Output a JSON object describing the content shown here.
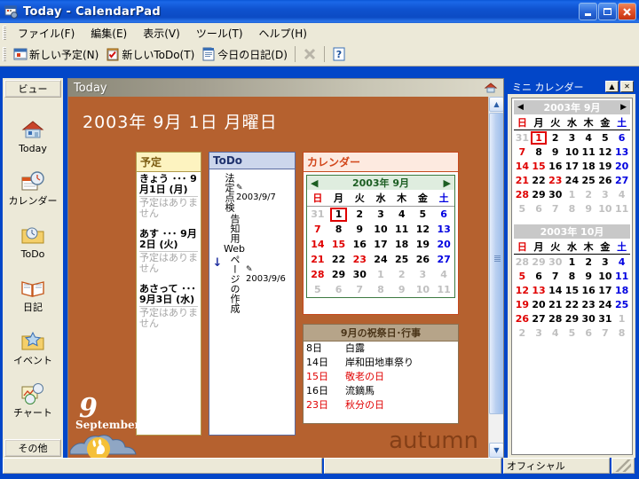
{
  "window": {
    "title": "Today - CalendarPad",
    "icon": "calendar-app-icon",
    "minimize": "_",
    "maximize": "□",
    "close": "✕"
  },
  "menubar": {
    "items": [
      {
        "label": "ファイル(F)",
        "name": "menu-file"
      },
      {
        "label": "編集(E)",
        "name": "menu-edit"
      },
      {
        "label": "表示(V)",
        "name": "menu-view"
      },
      {
        "label": "ツール(T)",
        "name": "menu-tools"
      },
      {
        "label": "ヘルプ(H)",
        "name": "menu-help"
      }
    ]
  },
  "toolbar": {
    "new_schedule": "新しい予定(N)",
    "new_todo": "新しいToDo(T)",
    "today_diary": "今日の日記(D)",
    "delete_label": "✕",
    "help_label": "?"
  },
  "sidebar": {
    "header": "ビュー",
    "footer": "その他",
    "items": [
      {
        "label": "Today",
        "icon": "house-icon"
      },
      {
        "label": "カレンダー",
        "icon": "calendar-clock-icon"
      },
      {
        "label": "ToDo",
        "icon": "folder-check-icon"
      },
      {
        "label": "日記",
        "icon": "open-book-icon"
      },
      {
        "label": "イベント",
        "icon": "folder-star-icon"
      },
      {
        "label": "チャート",
        "icon": "chart-clock-icon"
      }
    ]
  },
  "main": {
    "header_title": "Today",
    "header_icon": "house-icon",
    "big_date": "2003年 9月 1日 月曜日",
    "month_number": "9",
    "month_name": "September",
    "season_word": "autumn",
    "schedule_panel": {
      "title": "予定",
      "entries": [
        {
          "date": "きょう ･･･ 9月1日 (月)",
          "note": "予定はありません"
        },
        {
          "date": "あす ･･･ 9月2日 (火)",
          "note": "予定はありません"
        },
        {
          "date": "あさって ･･･ 9月3日 (水)",
          "note": "予定はありません"
        }
      ]
    },
    "todo_panel": {
      "title": "ToDo",
      "items": [
        {
          "marker": "",
          "text": "法定点検",
          "due": "2003/9/7",
          "due_icon": "pencil-icon"
        },
        {
          "marker": "↓",
          "text_pre": "告知用",
          "text_latin": "Web",
          "text_post": "ページの作成",
          "due": "2003/9/6",
          "due_icon": "pencil-icon"
        }
      ]
    },
    "calendar_panel": {
      "title": "カレンダー",
      "nav_prev": "◀",
      "nav_next": "▶",
      "month_title": "2003年 9月",
      "weekdays": [
        "日",
        "月",
        "火",
        "水",
        "木",
        "金",
        "土"
      ],
      "weeks": [
        [
          {
            "d": "31",
            "t": "out"
          },
          {
            "d": "1",
            "t": "today"
          },
          {
            "d": "2",
            "t": "wk"
          },
          {
            "d": "3",
            "t": "wk"
          },
          {
            "d": "4",
            "t": "wk"
          },
          {
            "d": "5",
            "t": "wk"
          },
          {
            "d": "6",
            "t": "sat"
          }
        ],
        [
          {
            "d": "7",
            "t": "sun"
          },
          {
            "d": "8",
            "t": "wk"
          },
          {
            "d": "9",
            "t": "wk"
          },
          {
            "d": "10",
            "t": "wk"
          },
          {
            "d": "11",
            "t": "wk"
          },
          {
            "d": "12",
            "t": "wk"
          },
          {
            "d": "13",
            "t": "sat"
          }
        ],
        [
          {
            "d": "14",
            "t": "sun"
          },
          {
            "d": "15",
            "t": "sun"
          },
          {
            "d": "16",
            "t": "wk"
          },
          {
            "d": "17",
            "t": "wk"
          },
          {
            "d": "18",
            "t": "wk"
          },
          {
            "d": "19",
            "t": "wk"
          },
          {
            "d": "20",
            "t": "sat"
          }
        ],
        [
          {
            "d": "21",
            "t": "sun"
          },
          {
            "d": "22",
            "t": "wk"
          },
          {
            "d": "23",
            "t": "sun"
          },
          {
            "d": "24",
            "t": "wk"
          },
          {
            "d": "25",
            "t": "wk"
          },
          {
            "d": "26",
            "t": "wk"
          },
          {
            "d": "27",
            "t": "sat"
          }
        ],
        [
          {
            "d": "28",
            "t": "sun"
          },
          {
            "d": "29",
            "t": "wk"
          },
          {
            "d": "30",
            "t": "wk"
          },
          {
            "d": "1",
            "t": "out"
          },
          {
            "d": "2",
            "t": "out"
          },
          {
            "d": "3",
            "t": "out"
          },
          {
            "d": "4",
            "t": "out"
          }
        ],
        [
          {
            "d": "5",
            "t": "out"
          },
          {
            "d": "6",
            "t": "out"
          },
          {
            "d": "7",
            "t": "out"
          },
          {
            "d": "8",
            "t": "out"
          },
          {
            "d": "9",
            "t": "out"
          },
          {
            "d": "10",
            "t": "out"
          },
          {
            "d": "11",
            "t": "out"
          }
        ]
      ]
    },
    "holiday_panel": {
      "title": "9月の祝祭日･行事",
      "rows": [
        {
          "day": "8日",
          "name": "白露",
          "red": false
        },
        {
          "day": "14日",
          "name": "岸和田地車祭り",
          "red": false
        },
        {
          "day": "15日",
          "name": "敬老の日",
          "red": true
        },
        {
          "day": "16日",
          "name": "流鏑馬",
          "red": false
        },
        {
          "day": "23日",
          "name": "秋分の日",
          "red": true
        }
      ]
    }
  },
  "dock": {
    "title": "ミニ カレンダー",
    "btn_roll": "▲",
    "btn_close": "✕",
    "months": [
      {
        "nav_prev": "◀",
        "nav_next": "▶",
        "title": "2003年 9月",
        "weekdays": [
          "日",
          "月",
          "火",
          "水",
          "木",
          "金",
          "土"
        ],
        "weeks": [
          [
            {
              "d": "31",
              "t": "out"
            },
            {
              "d": "1",
              "t": "today"
            },
            {
              "d": "2",
              "t": "wk"
            },
            {
              "d": "3",
              "t": "wk"
            },
            {
              "d": "4",
              "t": "wk"
            },
            {
              "d": "5",
              "t": "wk"
            },
            {
              "d": "6",
              "t": "sat"
            }
          ],
          [
            {
              "d": "7",
              "t": "sun"
            },
            {
              "d": "8",
              "t": "wk"
            },
            {
              "d": "9",
              "t": "wk"
            },
            {
              "d": "10",
              "t": "wk"
            },
            {
              "d": "11",
              "t": "wk"
            },
            {
              "d": "12",
              "t": "wk"
            },
            {
              "d": "13",
              "t": "sat"
            }
          ],
          [
            {
              "d": "14",
              "t": "sun"
            },
            {
              "d": "15",
              "t": "sun"
            },
            {
              "d": "16",
              "t": "wk"
            },
            {
              "d": "17",
              "t": "wk"
            },
            {
              "d": "18",
              "t": "wk"
            },
            {
              "d": "19",
              "t": "wk"
            },
            {
              "d": "20",
              "t": "sat"
            }
          ],
          [
            {
              "d": "21",
              "t": "sun"
            },
            {
              "d": "22",
              "t": "wk"
            },
            {
              "d": "23",
              "t": "sun"
            },
            {
              "d": "24",
              "t": "wk"
            },
            {
              "d": "25",
              "t": "wk"
            },
            {
              "d": "26",
              "t": "wk"
            },
            {
              "d": "27",
              "t": "sat"
            }
          ],
          [
            {
              "d": "28",
              "t": "sun"
            },
            {
              "d": "29",
              "t": "wk"
            },
            {
              "d": "30",
              "t": "wk"
            },
            {
              "d": "1",
              "t": "out"
            },
            {
              "d": "2",
              "t": "out"
            },
            {
              "d": "3",
              "t": "out"
            },
            {
              "d": "4",
              "t": "out"
            }
          ],
          [
            {
              "d": "5",
              "t": "out"
            },
            {
              "d": "6",
              "t": "out"
            },
            {
              "d": "7",
              "t": "out"
            },
            {
              "d": "8",
              "t": "out"
            },
            {
              "d": "9",
              "t": "out"
            },
            {
              "d": "10",
              "t": "out"
            },
            {
              "d": "11",
              "t": "out"
            }
          ]
        ]
      },
      {
        "nav_prev": "",
        "nav_next": "",
        "title": "2003年 10月",
        "weekdays": [
          "日",
          "月",
          "火",
          "水",
          "木",
          "金",
          "土"
        ],
        "weeks": [
          [
            {
              "d": "28",
              "t": "out"
            },
            {
              "d": "29",
              "t": "out"
            },
            {
              "d": "30",
              "t": "out"
            },
            {
              "d": "1",
              "t": "wk"
            },
            {
              "d": "2",
              "t": "wk"
            },
            {
              "d": "3",
              "t": "wk"
            },
            {
              "d": "4",
              "t": "sat"
            }
          ],
          [
            {
              "d": "5",
              "t": "sun"
            },
            {
              "d": "6",
              "t": "wk"
            },
            {
              "d": "7",
              "t": "wk"
            },
            {
              "d": "8",
              "t": "wk"
            },
            {
              "d": "9",
              "t": "wk"
            },
            {
              "d": "10",
              "t": "wk"
            },
            {
              "d": "11",
              "t": "sat"
            }
          ],
          [
            {
              "d": "12",
              "t": "sun"
            },
            {
              "d": "13",
              "t": "sun"
            },
            {
              "d": "14",
              "t": "wk"
            },
            {
              "d": "15",
              "t": "wk"
            },
            {
              "d": "16",
              "t": "wk"
            },
            {
              "d": "17",
              "t": "wk"
            },
            {
              "d": "18",
              "t": "sat"
            }
          ],
          [
            {
              "d": "19",
              "t": "sun"
            },
            {
              "d": "20",
              "t": "wk"
            },
            {
              "d": "21",
              "t": "wk"
            },
            {
              "d": "22",
              "t": "wk"
            },
            {
              "d": "23",
              "t": "wk"
            },
            {
              "d": "24",
              "t": "wk"
            },
            {
              "d": "25",
              "t": "sat"
            }
          ],
          [
            {
              "d": "26",
              "t": "sun"
            },
            {
              "d": "27",
              "t": "wk"
            },
            {
              "d": "28",
              "t": "wk"
            },
            {
              "d": "29",
              "t": "wk"
            },
            {
              "d": "30",
              "t": "wk"
            },
            {
              "d": "31",
              "t": "wk"
            },
            {
              "d": "1",
              "t": "out"
            }
          ],
          [
            {
              "d": "2",
              "t": "out"
            },
            {
              "d": "3",
              "t": "out"
            },
            {
              "d": "4",
              "t": "out"
            },
            {
              "d": "5",
              "t": "out"
            },
            {
              "d": "6",
              "t": "out"
            },
            {
              "d": "7",
              "t": "out"
            },
            {
              "d": "8",
              "t": "out"
            }
          ]
        ]
      }
    ]
  },
  "statusbar": {
    "pane1": "",
    "pane2": "",
    "pane3": "オフィシャル"
  },
  "colors": {
    "titlebar_blue": "#0246c8",
    "canvas_brown": "#b5612f",
    "accent_orange": "#c5481d",
    "sunday_red": "#e00000",
    "saturday_blue": "#0000e0"
  }
}
